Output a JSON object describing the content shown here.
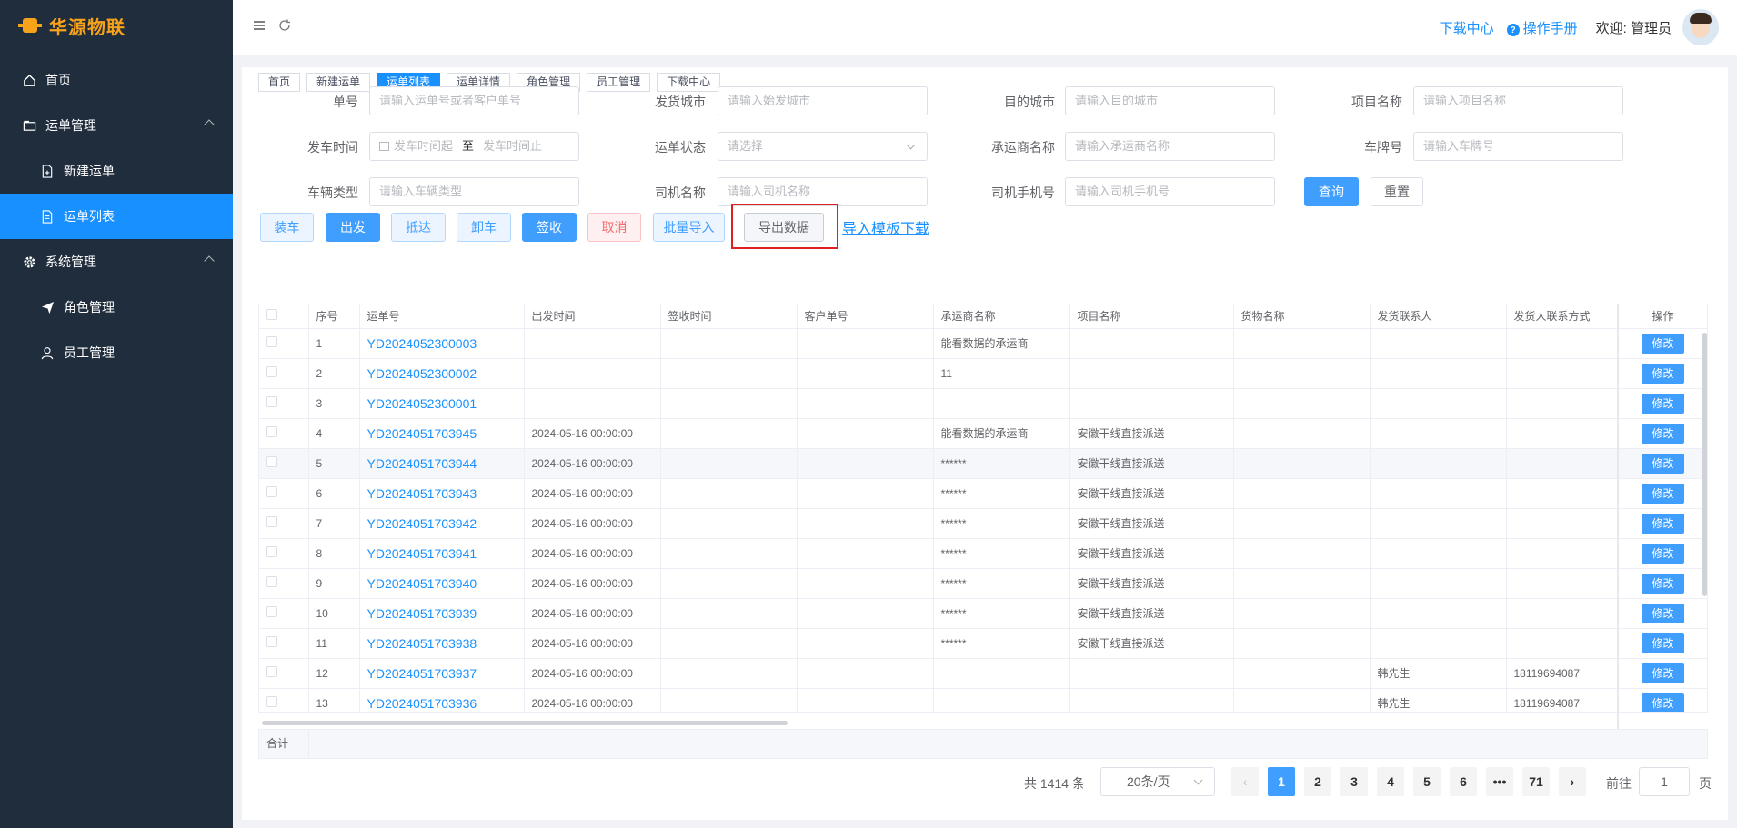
{
  "app": {
    "logo_text": "华源物联"
  },
  "sidebar": {
    "items": [
      {
        "label": "首页",
        "icon": "home-icon"
      },
      {
        "label": "运单管理",
        "icon": "folder-icon"
      },
      {
        "label": "新建运单",
        "icon": "file-plus-icon"
      },
      {
        "label": "运单列表",
        "icon": "file-list-icon"
      },
      {
        "label": "系统管理",
        "icon": "gear-icon"
      },
      {
        "label": "角色管理",
        "icon": "send-icon"
      },
      {
        "label": "员工管理",
        "icon": "user-icon"
      }
    ]
  },
  "header": {
    "download_center": "下载中心",
    "manual": "操作手册",
    "welcome": "欢迎: 管理员"
  },
  "tabs": [
    "首页",
    "新建运单",
    "运单列表",
    "运单详情",
    "角色管理",
    "员工管理",
    "下载中心"
  ],
  "filters": {
    "order_no": {
      "label": "单号",
      "placeholder": "请输入运单号或者客户单号"
    },
    "from_city": {
      "label": "发货城市",
      "placeholder": "请输入始发城市"
    },
    "to_city": {
      "label": "目的城市",
      "placeholder": "请输入目的城市"
    },
    "project": {
      "label": "项目名称",
      "placeholder": "请输入项目名称"
    },
    "depart_time": {
      "label": "发车时间",
      "start": "发车时间起",
      "sep": "至",
      "end": "发车时间止"
    },
    "status": {
      "label": "运单状态",
      "placeholder": "请选择"
    },
    "carrier": {
      "label": "承运商名称",
      "placeholder": "请输入承运商名称"
    },
    "plate": {
      "label": "车牌号",
      "placeholder": "请输入车牌号"
    },
    "vehicle_type": {
      "label": "车辆类型",
      "placeholder": "请输入车辆类型"
    },
    "driver": {
      "label": "司机名称",
      "placeholder": "请输入司机名称"
    },
    "driver_phone": {
      "label": "司机手机号",
      "placeholder": "请输入司机手机号"
    },
    "query": "查询",
    "reset": "重置"
  },
  "actions": {
    "load": "装车",
    "depart": "出发",
    "arrive": "抵达",
    "unload": "卸车",
    "sign": "签收",
    "cancel": "取消",
    "batch_import": "批量导入",
    "export": "导出数据",
    "template": "导入模板下载"
  },
  "table": {
    "headers": [
      "序号",
      "运单号",
      "出发时间",
      "签收时间",
      "客户单号",
      "承运商名称",
      "项目名称",
      "货物名称",
      "发货联系人",
      "发货人联系方式",
      "操作"
    ],
    "op_label": "修改",
    "rows": [
      [
        "1",
        "YD2024052300003",
        "",
        "",
        "",
        "能看数据的承运商",
        "",
        "",
        "",
        ""
      ],
      [
        "2",
        "YD2024052300002",
        "",
        "",
        "",
        "11",
        "",
        "",
        "",
        ""
      ],
      [
        "3",
        "YD2024052300001",
        "",
        "",
        "",
        "",
        "",
        "",
        "",
        ""
      ],
      [
        "4",
        "YD2024051703945",
        "2024-05-16 00:00:00",
        "",
        "",
        "能看数据的承运商",
        "安徽干线直接派送",
        "",
        "",
        ""
      ],
      [
        "5",
        "YD2024051703944",
        "2024-05-16 00:00:00",
        "",
        "",
        "******",
        "安徽干线直接派送",
        "",
        "",
        ""
      ],
      [
        "6",
        "YD2024051703943",
        "2024-05-16 00:00:00",
        "",
        "",
        "******",
        "安徽干线直接派送",
        "",
        "",
        ""
      ],
      [
        "7",
        "YD2024051703942",
        "2024-05-16 00:00:00",
        "",
        "",
        "******",
        "安徽干线直接派送",
        "",
        "",
        ""
      ],
      [
        "8",
        "YD2024051703941",
        "2024-05-16 00:00:00",
        "",
        "",
        "******",
        "安徽干线直接派送",
        "",
        "",
        ""
      ],
      [
        "9",
        "YD2024051703940",
        "2024-05-16 00:00:00",
        "",
        "",
        "******",
        "安徽干线直接派送",
        "",
        "",
        ""
      ],
      [
        "10",
        "YD2024051703939",
        "2024-05-16 00:00:00",
        "",
        "",
        "******",
        "安徽干线直接派送",
        "",
        "",
        ""
      ],
      [
        "11",
        "YD2024051703938",
        "2024-05-16 00:00:00",
        "",
        "",
        "******",
        "安徽干线直接派送",
        "",
        "",
        ""
      ],
      [
        "12",
        "YD2024051703937",
        "2024-05-16 00:00:00",
        "",
        "",
        "",
        "",
        "",
        "韩先生",
        "18119694087"
      ],
      [
        "13",
        "YD2024051703936",
        "2024-05-16 00:00:00",
        "",
        "",
        "",
        "",
        "",
        "韩先生",
        "18119694087"
      ]
    ],
    "sum_label": "合计"
  },
  "pagination": {
    "total": "共 1414 条",
    "page_size": "20条/页",
    "pages": [
      "1",
      "2",
      "3",
      "4",
      "5",
      "6",
      "•••",
      "71"
    ],
    "goto_label": "前往",
    "goto_value": "1",
    "page_suffix": "页"
  }
}
